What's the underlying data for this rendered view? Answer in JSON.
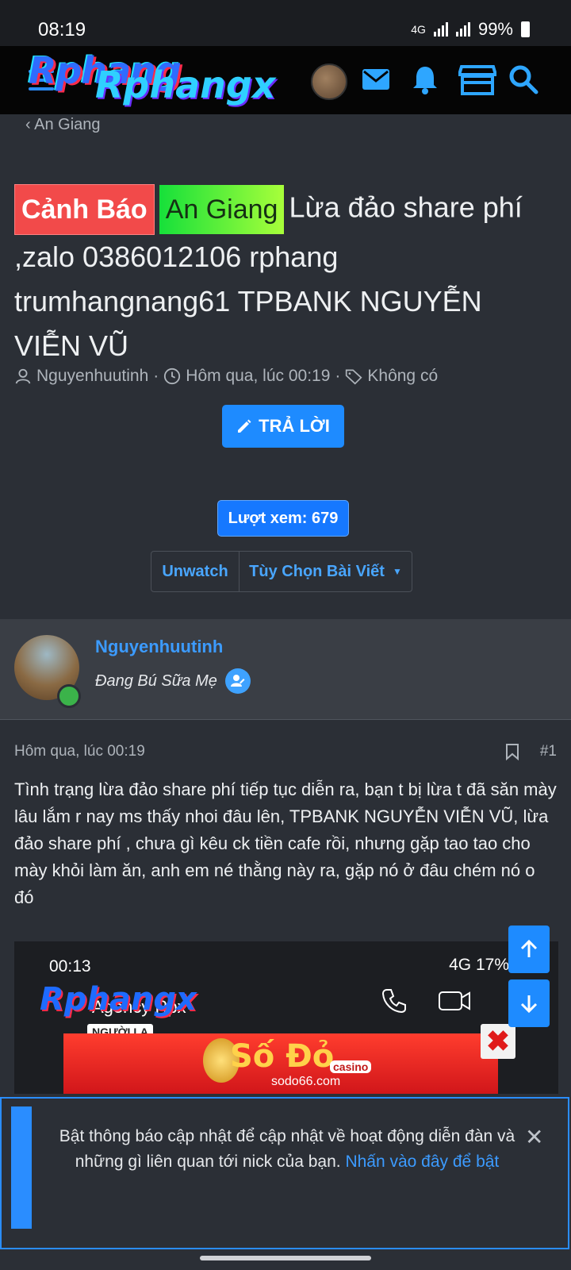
{
  "status_bar": {
    "time": "08:19",
    "network": "4G",
    "battery": "99%"
  },
  "header": {
    "logo_text": "Rphang",
    "logo_text2": "Rphangx"
  },
  "breadcrumb": {
    "label": "An Giang"
  },
  "thread": {
    "prefix_warning": "Cảnh Báo",
    "prefix_region": "An Giang",
    "title": "Lừa đảo share phí ,zalo 0386012106 rphang trumhangnang61 TPBANK NGUYỄN VIỄN VŨ",
    "author": "Nguyenhuutinh",
    "date": "Hôm qua, lúc 00:19",
    "tags": "Không có",
    "reply_button": "TRẢ LỜI",
    "views": "Lượt xem: 679",
    "unwatch": "Unwatch",
    "options": "Tùy Chọn Bài Viết"
  },
  "post": {
    "username": "Nguyenhuutinh",
    "user_title": "Đang Bú Sữa Mẹ",
    "date": "Hôm qua, lúc 00:19",
    "number": "#1",
    "body": "Tình trạng lừa đảo share phí tiếp tục diễn ra, bạn t bị lừa t đã săn mày lâu lắm r nay ms thấy nhoi đâu lên, TPBANK NGUYỄN VIỄN VŨ, lừa đảo share phí , chưa gì kêu ck tiền cafe rồi, nhưng gặp tao tao cho mày khỏi làm ăn, anh em né thằng này ra, gặp nó ở đâu chém nó o đó"
  },
  "embedded_image": {
    "time": "00:13",
    "status": "4G 17%",
    "contact_name": "Agency Rpx",
    "contact_note": "NGƯỜI LẠ",
    "watermark": "Rphangx",
    "ad_brand": "Số Đỏ",
    "ad_tag": "casino",
    "ad_url": "sodo66.com",
    "ad_close": "✖"
  },
  "notice": {
    "text": "Bật thông báo cập nhật để cập nhật về hoạt động diễn đàn và những gì liên quan tới nick của bạn.",
    "link": "Nhấn vào đây để bật",
    "close": "✕"
  },
  "colors": {
    "accent": "#1e8bff",
    "background": "#2b2f36",
    "warning": "#f24a4a",
    "region": "#22e03a"
  }
}
